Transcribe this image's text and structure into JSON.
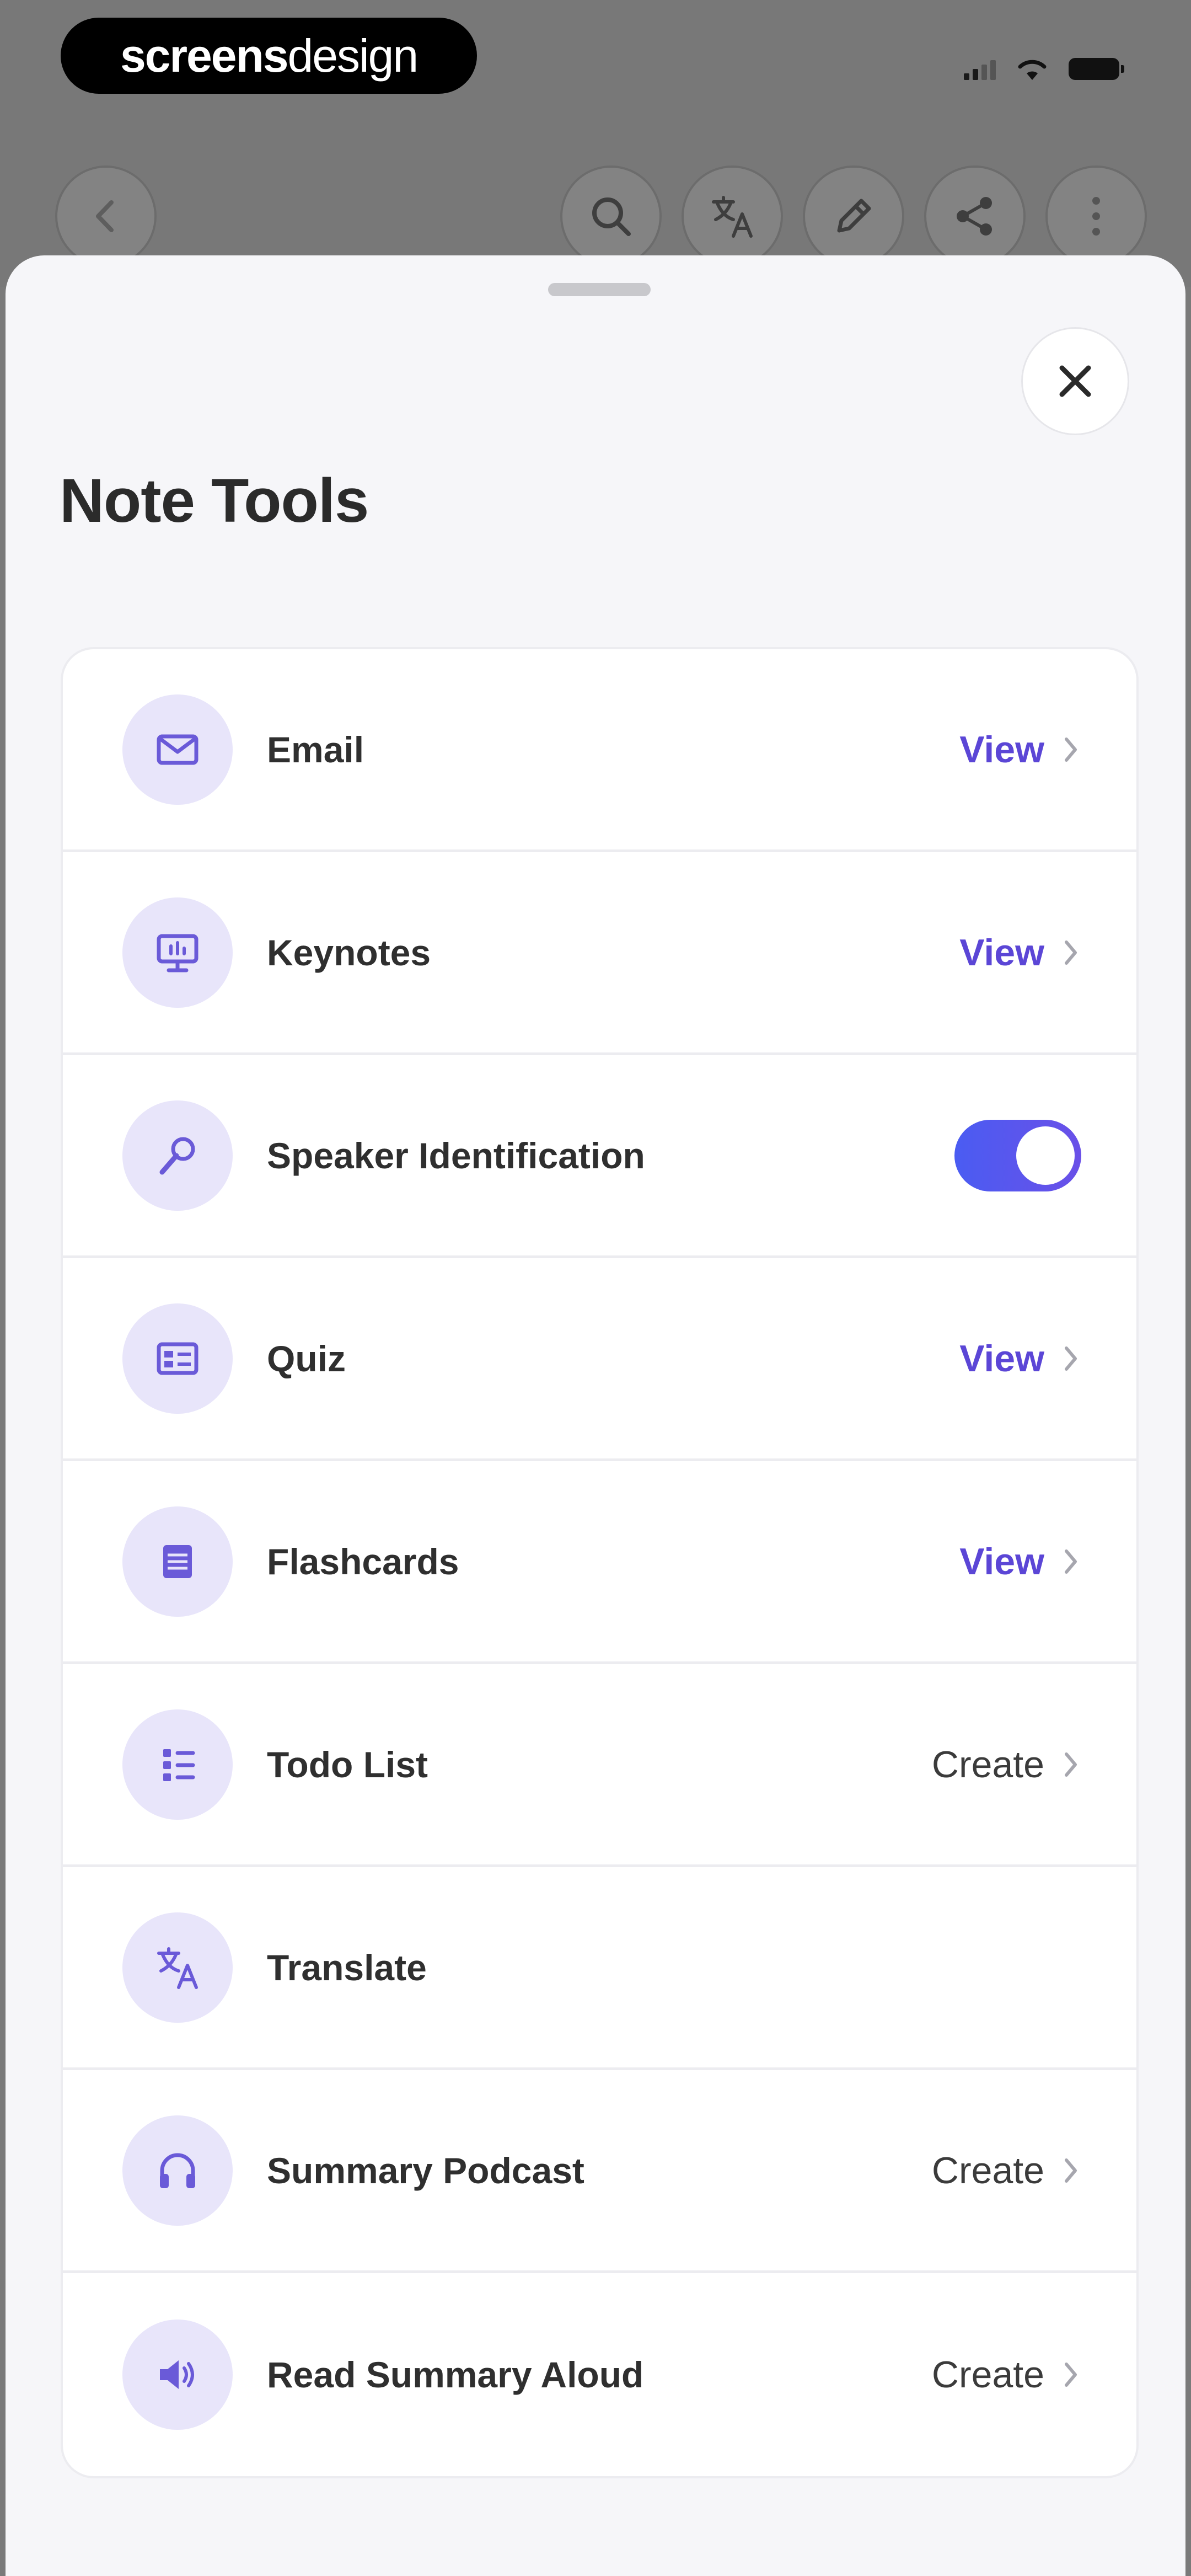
{
  "watermark": {
    "bold": "screens",
    "light": "design"
  },
  "sheet": {
    "title": "Note Tools"
  },
  "colors": {
    "accent": "#5b46d6",
    "icon_bg": "#e8e5fa",
    "toggle_on": "#4a5cf2"
  },
  "tools": [
    {
      "label": "Email",
      "icon": "mail-icon",
      "action": "View",
      "action_type": "view"
    },
    {
      "label": "Keynotes",
      "icon": "presentation-icon",
      "action": "View",
      "action_type": "view"
    },
    {
      "label": "Speaker Identification",
      "icon": "microphone-icon",
      "action_type": "toggle",
      "toggle_on": true
    },
    {
      "label": "Quiz",
      "icon": "quiz-icon",
      "action": "View",
      "action_type": "view"
    },
    {
      "label": "Flashcards",
      "icon": "flashcards-icon",
      "action": "View",
      "action_type": "view"
    },
    {
      "label": "Todo List",
      "icon": "checklist-icon",
      "action": "Create",
      "action_type": "create"
    },
    {
      "label": "Translate",
      "icon": "translate-icon",
      "action_type": "none"
    },
    {
      "label": "Summary Podcast",
      "icon": "headphones-icon",
      "action": "Create",
      "action_type": "create"
    },
    {
      "label": "Read Summary Aloud",
      "icon": "speaker-icon",
      "action": "Create",
      "action_type": "create"
    }
  ]
}
